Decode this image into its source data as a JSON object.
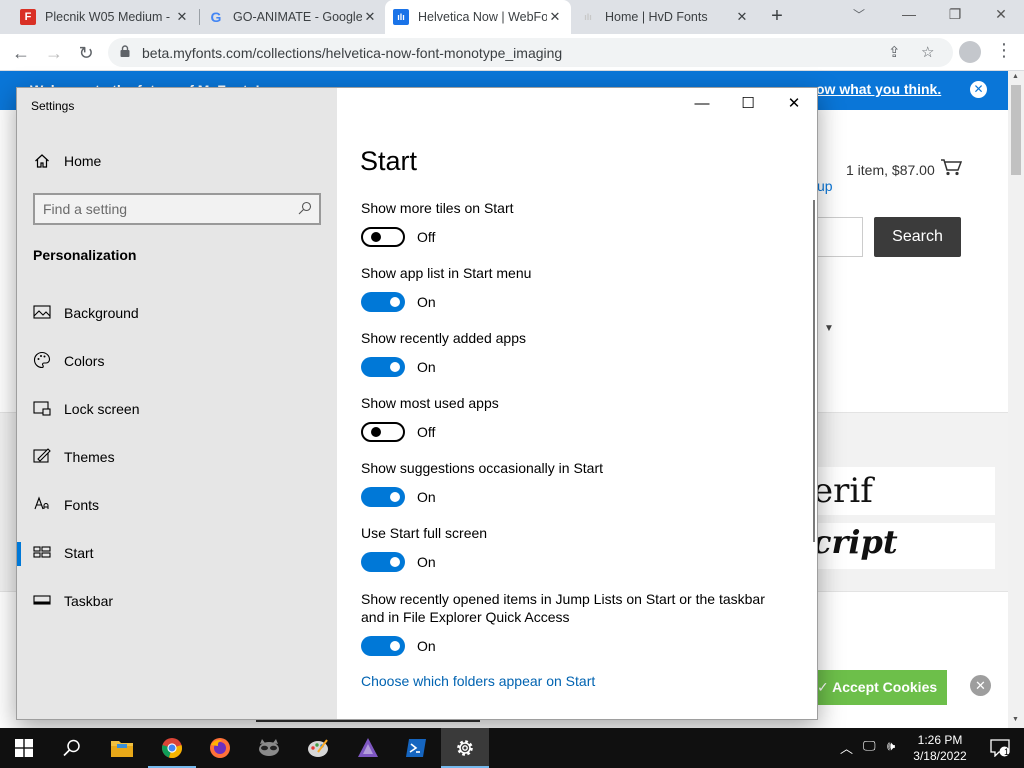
{
  "browser": {
    "tabs": [
      {
        "title": "Plecnik W05 Medium - ",
        "favicon": "F",
        "favicon_color": "#d93025"
      },
      {
        "title": "GO-ANIMATE - Google",
        "favicon": "G",
        "favicon_color": "#4285f4"
      },
      {
        "title": "Helvetica Now | WebFo",
        "favicon": "fonts-icon",
        "favicon_color": "#1a73e8"
      },
      {
        "title": "Home | HvD Fonts",
        "favicon": "hvd-icon",
        "favicon_color": "#e0e0e0"
      }
    ],
    "url": "beta.myfonts.com/collections/helvetica-now-font-monotype_imaging"
  },
  "webpage": {
    "banner_text": "Welcome to the future of MyFonts! ...",
    "banner_link": "ow what you think.",
    "cart_text": "1 item, $87.00",
    "cart_fragment": "up",
    "search_button": "Search",
    "serif_sample": "erif",
    "script_sample": "cript",
    "accept_cookies": "✓ Accept Cookies",
    "accent_color": "#0a76d8"
  },
  "settings": {
    "app_title": "Settings",
    "home_label": "Home",
    "search_placeholder": "Find a setting",
    "section_header": "Personalization",
    "nav": [
      {
        "label": "Background",
        "icon": "picture-icon"
      },
      {
        "label": "Colors",
        "icon": "palette-icon"
      },
      {
        "label": "Lock screen",
        "icon": "lock-screen-icon"
      },
      {
        "label": "Themes",
        "icon": "themes-icon"
      },
      {
        "label": "Fonts",
        "icon": "fonts-icon"
      },
      {
        "label": "Start",
        "icon": "start-icon",
        "selected": true
      },
      {
        "label": "Taskbar",
        "icon": "taskbar-icon"
      }
    ],
    "page_title": "Start",
    "options": [
      {
        "label": "Show more tiles on Start",
        "state": "Off",
        "on": false
      },
      {
        "label": "Show app list in Start menu",
        "state": "On",
        "on": true
      },
      {
        "label": "Show recently added apps",
        "state": "On",
        "on": true
      },
      {
        "label": "Show most used apps",
        "state": "Off",
        "on": false
      },
      {
        "label": "Show suggestions occasionally in Start",
        "state": "On",
        "on": true
      },
      {
        "label": "Use Start full screen",
        "state": "On",
        "on": true
      },
      {
        "label": "Show recently opened items in Jump Lists on Start or the taskbar and in File Explorer Quick Access",
        "state": "On",
        "on": true
      }
    ],
    "folders_link": "Choose which folders appear on Start",
    "accent_color": "#0078d7"
  },
  "taskbar": {
    "time": "1:26 PM",
    "date": "3/18/2022",
    "notification_count": "1"
  }
}
